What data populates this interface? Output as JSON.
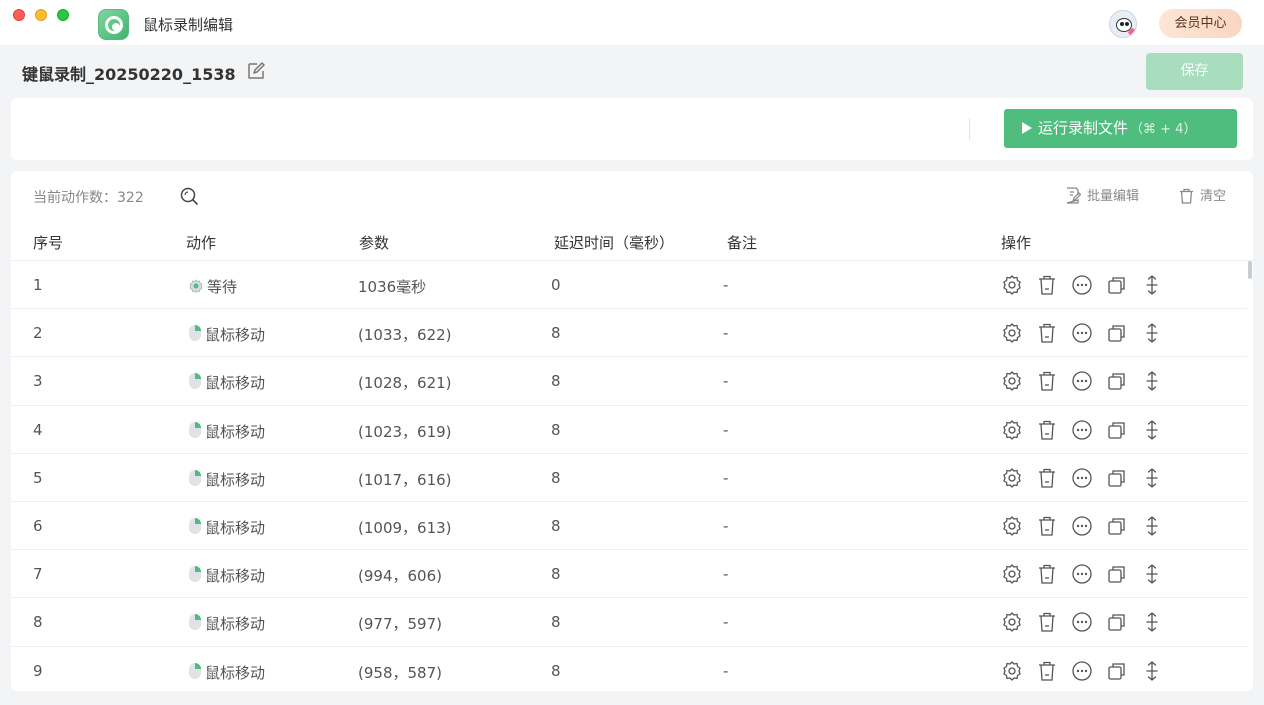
{
  "window": {
    "app_title": "鼠标录制编辑",
    "vip_label": "会员中心"
  },
  "header": {
    "doc_title": "键鼠录制_20250220_1538",
    "save_label": "保存"
  },
  "run": {
    "label": "运行录制文件",
    "shortcut": "（⌘ + 4）"
  },
  "toolbar": {
    "count_label": "当前动作数：322",
    "batch_edit": "批量编辑",
    "clear": "清空"
  },
  "table": {
    "columns": [
      "序号",
      "动作",
      "参数",
      "延迟时间（毫秒）",
      "备注",
      "操作"
    ],
    "rows": [
      {
        "idx": "1",
        "action": "等待",
        "type": "wait",
        "param": "1036毫秒",
        "delay": "0",
        "note": "-"
      },
      {
        "idx": "2",
        "action": "鼠标移动",
        "type": "mouse",
        "param": "(1033，622)",
        "delay": "8",
        "note": "-"
      },
      {
        "idx": "3",
        "action": "鼠标移动",
        "type": "mouse",
        "param": "(1028，621)",
        "delay": "8",
        "note": "-"
      },
      {
        "idx": "4",
        "action": "鼠标移动",
        "type": "mouse",
        "param": "(1023，619)",
        "delay": "8",
        "note": "-"
      },
      {
        "idx": "5",
        "action": "鼠标移动",
        "type": "mouse",
        "param": "(1017，616)",
        "delay": "8",
        "note": "-"
      },
      {
        "idx": "6",
        "action": "鼠标移动",
        "type": "mouse",
        "param": "(1009，613)",
        "delay": "8",
        "note": "-"
      },
      {
        "idx": "7",
        "action": "鼠标移动",
        "type": "mouse",
        "param": "(994，606)",
        "delay": "8",
        "note": "-"
      },
      {
        "idx": "8",
        "action": "鼠标移动",
        "type": "mouse",
        "param": "(977，597)",
        "delay": "8",
        "note": "-"
      },
      {
        "idx": "9",
        "action": "鼠标移动",
        "type": "mouse",
        "param": "(958，587)",
        "delay": "8",
        "note": "-"
      }
    ]
  },
  "colors": {
    "accent": "#4fbd7d",
    "save_disabled": "#a8ddbd"
  }
}
